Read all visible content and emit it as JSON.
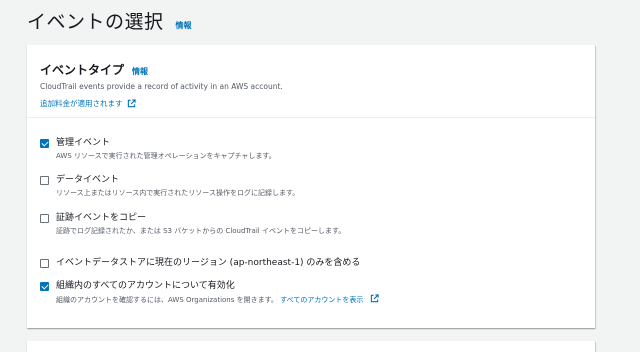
{
  "header": {
    "title": "イベントの選択",
    "info": "情報"
  },
  "panel": {
    "title": "イベントタイプ",
    "info": "情報",
    "description": "CloudTrail events provide a record of activity in an AWS account.",
    "pricing_link": "追加料金が適用されます"
  },
  "options": [
    {
      "label": "管理イベント",
      "description": "AWS リソースで実行された管理オペレーションをキャプチャします。",
      "checked": true
    },
    {
      "label": "データイベント",
      "description": "リソース上またはリソース内で実行されたリソース操作をログに記録します。",
      "checked": false
    },
    {
      "label": "証跡イベントをコピー",
      "description": "証跡でログ記録されたか、または S3 バケットからの CloudTrail イベントをコピーします。",
      "checked": false
    }
  ],
  "region_option": {
    "label": "イベントデータストアに現在のリージョン (ap-northeast-1) のみを含める",
    "checked": false
  },
  "org_option": {
    "label": "組織内のすべてのアカウントについて有効化",
    "description": "組織のアカウントを確認するには、AWS Organizations を開きます。",
    "link": "すべてのアカウントを表示",
    "checked": true
  },
  "colors": {
    "link": "#0073bb",
    "checkbox_checked": "#0073bb"
  }
}
